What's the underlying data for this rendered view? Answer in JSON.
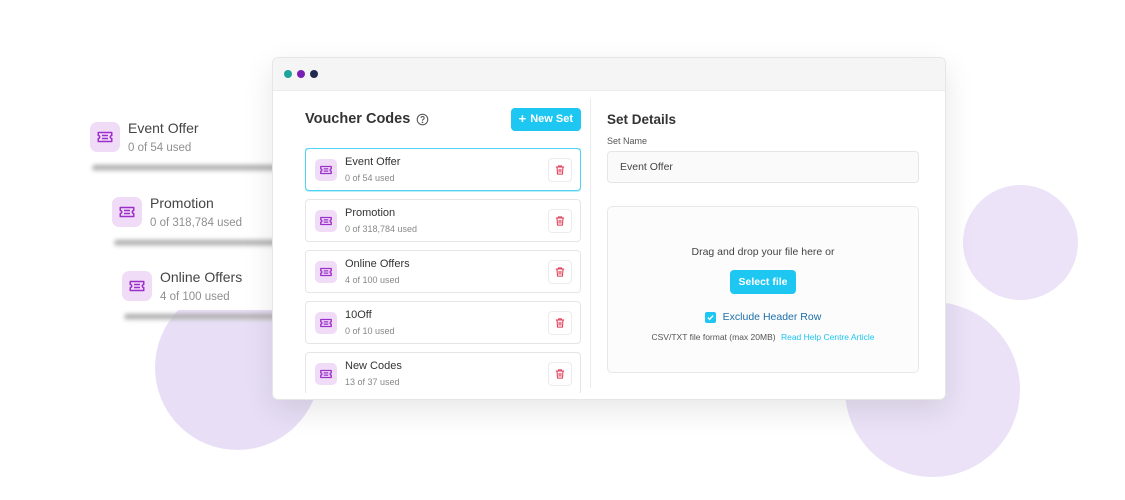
{
  "floating_cards": [
    {
      "title": "Event Offer",
      "usage": "0 of 54 used"
    },
    {
      "title": "Promotion",
      "usage": "0 of 318,784 used"
    },
    {
      "title": "Online Offers",
      "usage": "4 of 100 used"
    }
  ],
  "voucher_codes": {
    "title": "Voucher Codes",
    "new_set_label": "New Set",
    "items": [
      {
        "title": "Event Offer",
        "usage": "0 of 54 used",
        "selected": true
      },
      {
        "title": "Promotion",
        "usage": "0 of 318,784 used"
      },
      {
        "title": "Online Offers",
        "usage": "4 of 100 used"
      },
      {
        "title": "10Off",
        "usage": "0 of 10 used"
      },
      {
        "title": "New Codes",
        "usage": "13 of 37 used"
      }
    ]
  },
  "set_details": {
    "title": "Set Details",
    "set_name_label": "Set Name",
    "set_name_value": "Event Offer",
    "drop_text": "Drag and drop your file here or",
    "select_file_label": "Select file",
    "exclude_header_label": "Exclude Header Row",
    "exclude_header_checked": true,
    "format_text": "CSV/TXT file format (max 20MB)",
    "help_link": "Read Help Centre Article"
  },
  "colors": {
    "accent": "#1ec6f2",
    "icon_bg": "#f0dcf7",
    "icon_fg": "#9b2fc9",
    "trash": "#e23b55",
    "dot_teal": "#1fa39a",
    "dot_purple": "#7a1fb3",
    "dot_navy": "#222a4f"
  },
  "icons": {
    "voucher": "ticket-icon",
    "delete": "trash-icon",
    "help": "question-circle-icon"
  }
}
